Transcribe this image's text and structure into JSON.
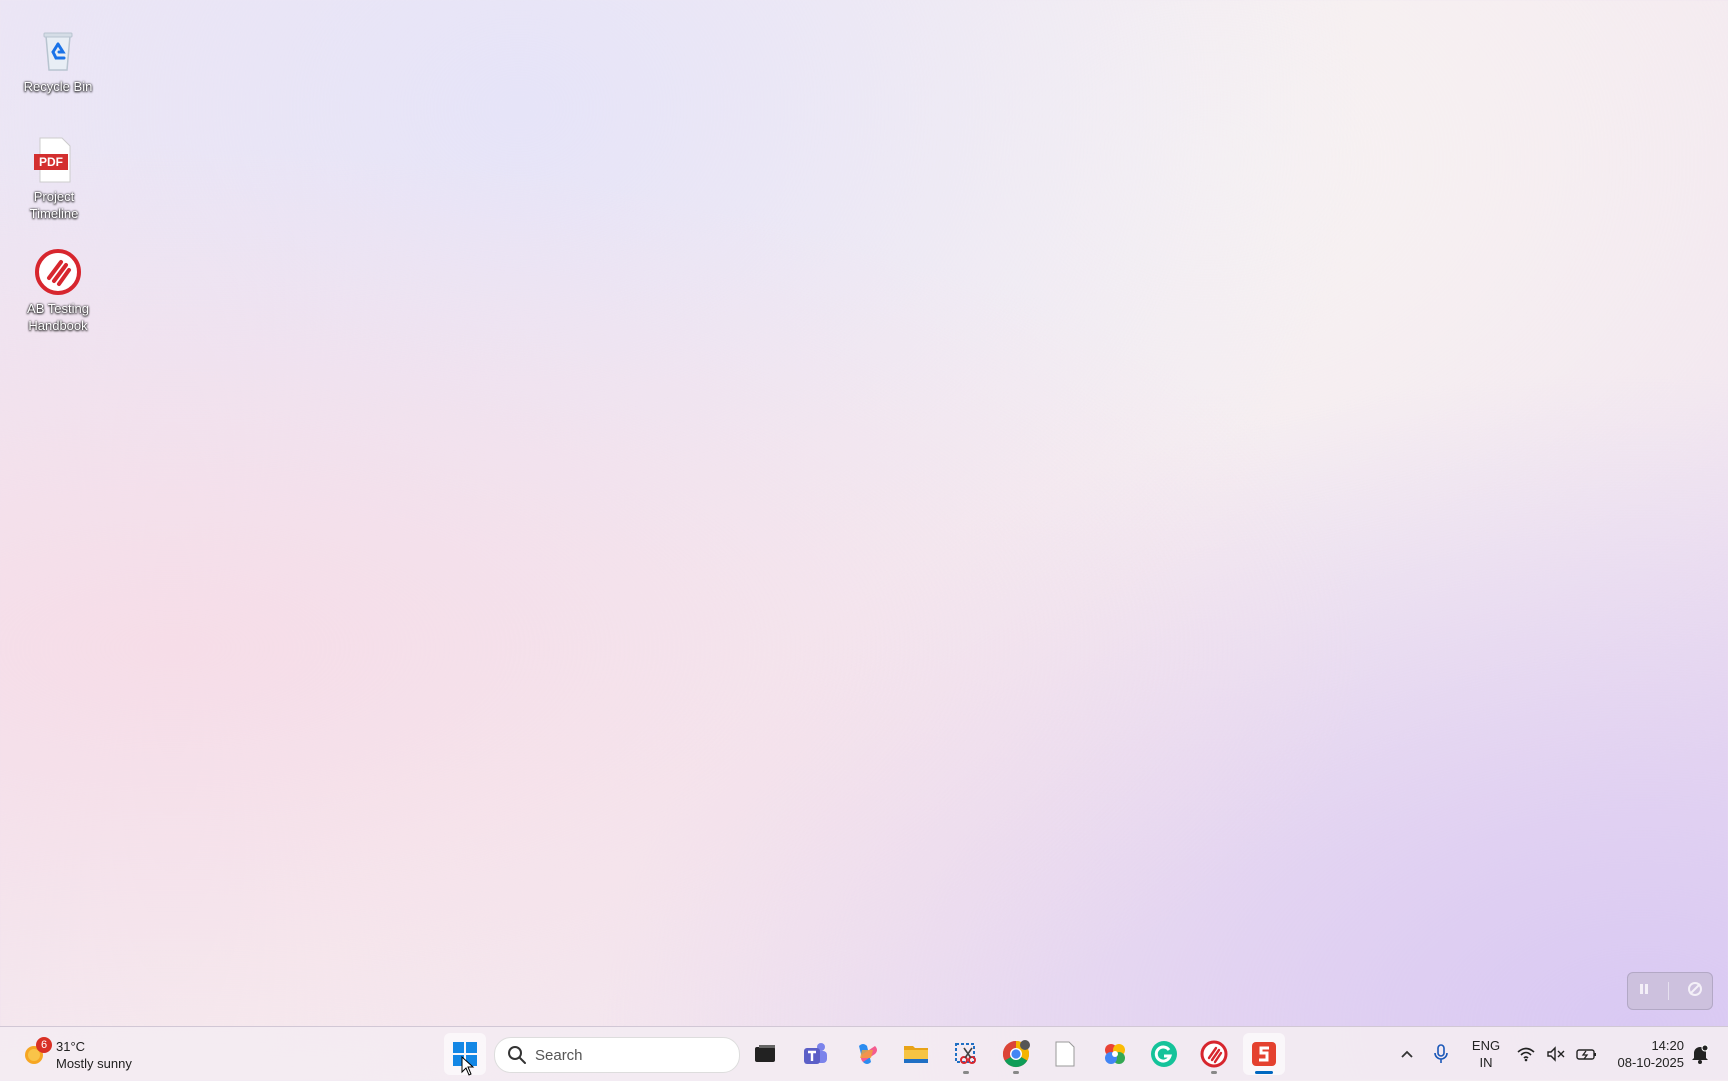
{
  "desktop": {
    "icons": [
      {
        "label": "Recycle Bin"
      },
      {
        "label": "Project Timeline",
        "badge": "PDF"
      },
      {
        "label": "AB Testing Handbook"
      }
    ]
  },
  "taskbar": {
    "weather": {
      "badge": "6",
      "temperature": "31°C",
      "condition": "Mostly sunny"
    },
    "search": {
      "placeholder": "Search"
    },
    "apps": [
      "start",
      "task-view",
      "teams",
      "copilot",
      "file-explorer",
      "snipping-tool",
      "chrome",
      "notepad",
      "photos",
      "grammarly",
      "ab-tasty",
      "slides"
    ],
    "tray": {
      "language": "ENG",
      "region": "IN",
      "time": "14:20",
      "date": "08-10-2025"
    }
  },
  "colors": {
    "accent": "#0067c0",
    "red": "#d7262e",
    "teams_purple": "#5b5fc7",
    "grammarly_green": "#15c39a"
  }
}
